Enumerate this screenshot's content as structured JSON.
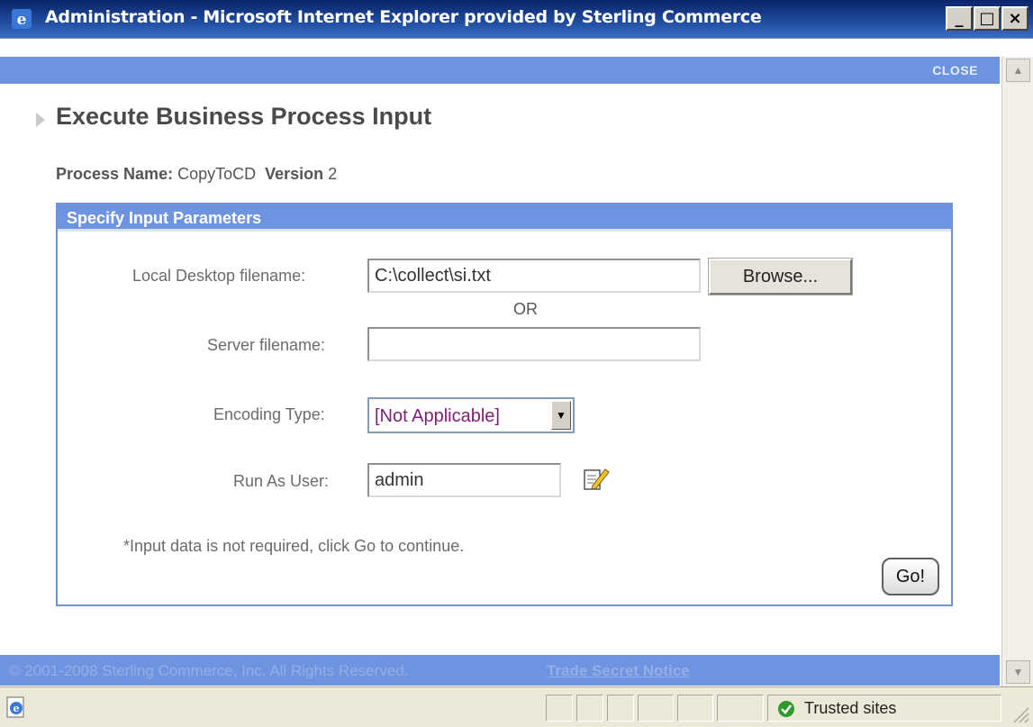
{
  "window": {
    "title": "Administration - Microsoft Internet Explorer provided by Sterling Commerce",
    "minimize_glyph": "_",
    "maximize_glyph": "□",
    "close_glyph": "×"
  },
  "header": {
    "close_label": "CLOSE"
  },
  "page": {
    "title": "Execute Business Process Input",
    "process_name_label": "Process Name:",
    "process_name_value": "CopyToCD",
    "version_label": "Version",
    "version_value": "2"
  },
  "panel": {
    "header": "Specify Input Parameters",
    "local_file_label": "Local Desktop filename:",
    "local_file_value": "C:\\collect\\si.txt",
    "browse_label": "Browse...",
    "or_label": "OR",
    "server_file_label": "Server filename:",
    "server_file_value": "",
    "encoding_label": "Encoding Type:",
    "encoding_value": "[Not Applicable]",
    "run_as_label": "Run As User:",
    "run_as_value": "admin",
    "note": "*Input data is not required, click Go to continue.",
    "go_label": "Go!"
  },
  "footer": {
    "copyright": "© 2001-2008 Sterling Commerce, Inc. All Rights Reserved.",
    "trade_link": "Trade Secret Notice"
  },
  "statusbar": {
    "zone": "Trusted sites"
  },
  "colors": {
    "accent_blue": "#6f94df",
    "title_bar": "#0a246a",
    "select_text": "#7b1e74"
  },
  "icons": [
    "ie-icon",
    "arrow-right-icon",
    "edit-icon",
    "check-icon",
    "chevron-down-icon"
  ]
}
